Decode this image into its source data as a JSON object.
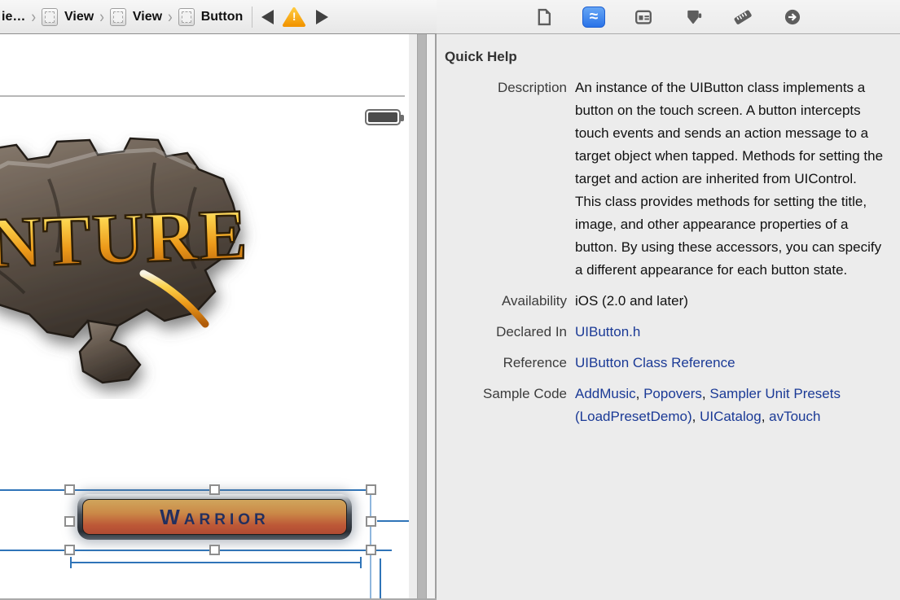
{
  "jump_bar": {
    "items": [
      {
        "label": "ie…",
        "has_icon": false
      },
      {
        "label": "View",
        "has_icon": true
      },
      {
        "label": "View",
        "has_icon": true
      },
      {
        "label": "Button",
        "has_icon": true
      }
    ],
    "warning_glyph": "!"
  },
  "canvas": {
    "logo_text": "NTURE",
    "button_label": "WARRIOR"
  },
  "inspector": {
    "toolbar_icons": [
      {
        "name": "file-inspector-icon",
        "selected": false
      },
      {
        "name": "quick-help-inspector-icon",
        "selected": true
      },
      {
        "name": "identity-inspector-icon",
        "selected": false
      },
      {
        "name": "attributes-inspector-icon",
        "selected": false
      },
      {
        "name": "size-inspector-icon",
        "selected": false
      },
      {
        "name": "connections-inspector-icon",
        "selected": false
      }
    ],
    "quick_help_glyph": "≈",
    "title": "Quick Help",
    "rows": [
      {
        "label": "Description",
        "text": "An instance of the UIButton class implements a button on the touch screen. A button intercepts touch events and sends an action message to a target object when tapped. Methods for setting the target and action are inherited from UIControl. This class provides methods for setting the title, image, and other appearance properties of a button. By using these accessors, you can specify a different appearance for each button state."
      },
      {
        "label": "Availability",
        "text": "iOS (2.0 and later)"
      },
      {
        "label": "Declared In",
        "links": [
          "UIButton.h"
        ]
      },
      {
        "label": "Reference",
        "links": [
          "UIButton Class Reference"
        ]
      },
      {
        "label": "Sample Code",
        "links": [
          "AddMusic",
          "Popovers",
          "Sampler Unit Presets (LoadPresetDemo)",
          "UICatalog",
          "avTouch"
        ]
      }
    ],
    "colors": {
      "link": "#1b3a96",
      "selected_tab": "#2a73e8"
    }
  }
}
